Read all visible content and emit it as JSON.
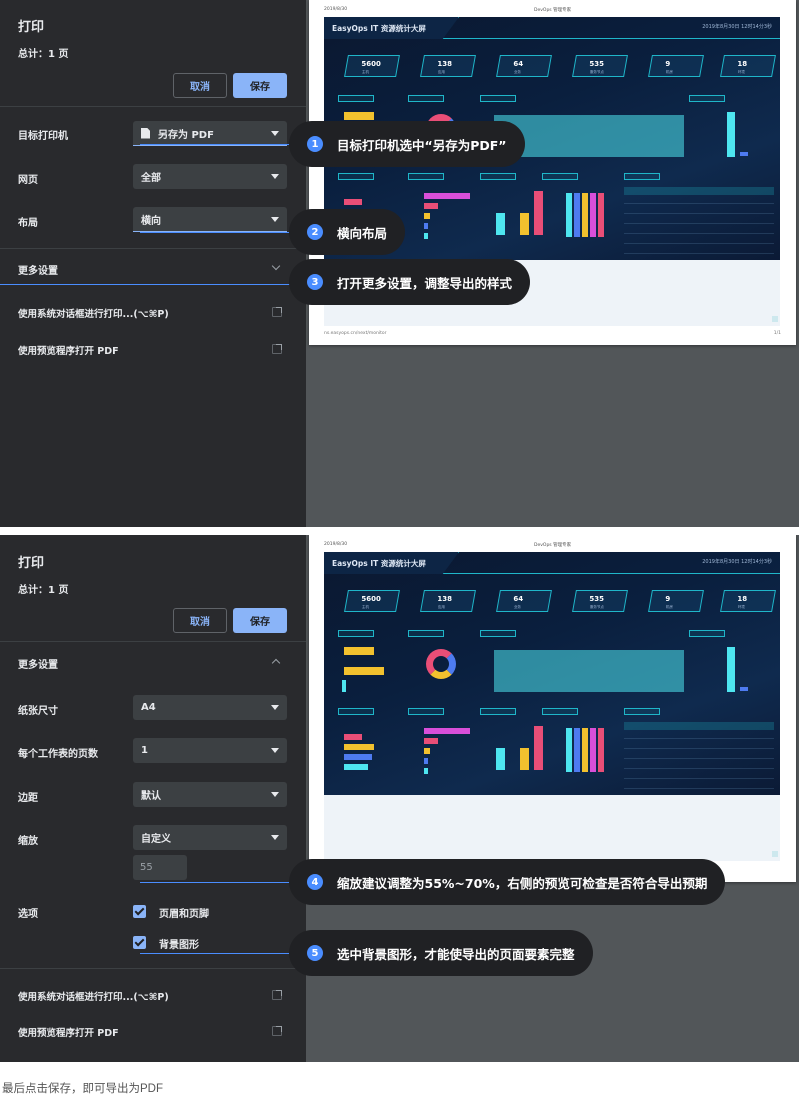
{
  "panel1": {
    "title": "打印",
    "total": "总计：1 页",
    "cancel_label": "取消",
    "save_label": "保存",
    "destination_label": "目标打印机",
    "destination_value": "另存为 PDF",
    "pages_label": "网页",
    "pages_value": "全部",
    "layout_label": "布局",
    "layout_value": "横向",
    "more_settings_label": "更多设置",
    "system_dialog_label": "使用系统对话框进行打印...(⌥⌘P)",
    "preview_open_label": "使用预览程序打开 PDF",
    "annotations": [
      {
        "num": "1",
        "text": "目标打印机选中“另存为PDF”"
      },
      {
        "num": "2",
        "text": "横向布局"
      },
      {
        "num": "3",
        "text": "打开更多设置，调整导出的样式"
      }
    ]
  },
  "panel2": {
    "title": "打印",
    "total": "总计：1 页",
    "cancel_label": "取消",
    "save_label": "保存",
    "more_settings_label": "更多设置",
    "paper_size_label": "纸张尺寸",
    "paper_size_value": "A4",
    "pages_per_sheet_label": "每个工作表的页数",
    "pages_per_sheet_value": "1",
    "margins_label": "边距",
    "margins_value": "默认",
    "scale_label": "缩放",
    "scale_value": "自定义",
    "scale_input": "55",
    "options_label": "选项",
    "option_headers": "页眉和页脚",
    "option_background": "背景图形",
    "system_dialog_label": "使用系统对话框进行打印...(⌥⌘P)",
    "preview_open_label": "使用预览程序打开 PDF",
    "annotations": [
      {
        "num": "4",
        "text": "缩放建议调整为55%~70%，右侧的预览可检查是否符合导出预期"
      },
      {
        "num": "5",
        "text": "选中背景图形，才能使导出的页面要素完整"
      }
    ]
  },
  "preview": {
    "page_date": "2019/8/30",
    "page_title": "DevOps 管理专家",
    "dash_title": "EasyOps  IT 资源统计大屏",
    "dash_time": "2019年8月30日    12时14分3秒",
    "kpis": [
      {
        "value": "5600",
        "label": "主机"
      },
      {
        "value": "138",
        "label": "应用"
      },
      {
        "value": "64",
        "label": "业务"
      },
      {
        "value": "535",
        "label": "服务节点"
      },
      {
        "value": "9",
        "label": "机房"
      },
      {
        "value": "18",
        "label": "环境"
      }
    ],
    "footer_url": "ns.easyops.cn/next/monitor",
    "footer_page": "1/1"
  },
  "caption": "最后点击保存，即可导出为PDF",
  "colors": {
    "sidebar": "#292a2d",
    "accent": "#8ab4f8",
    "annotation_badge": "#4a8dff",
    "dashboard_bg": "#0a1f3e",
    "dashboard_line": "#1fb6c9"
  }
}
